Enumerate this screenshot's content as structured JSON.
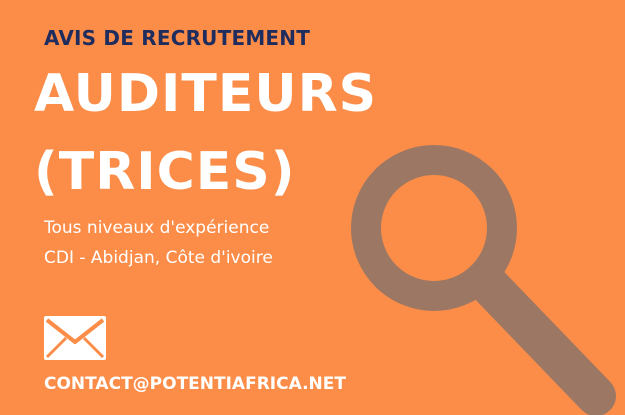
{
  "poster": {
    "kicker": "AVIS DE RECRUTEMENT",
    "headline_line1": "AUDITEURS",
    "headline_line2": "(TRICES)",
    "details": [
      "Tous niveaux d'expérience",
      "CDI - Abidjan, Côte d'ivoire"
    ],
    "contact_email": "CONTACT@POTENTIAFRICA.NET"
  },
  "icons": {
    "magnifier": "magnifying-glass-icon",
    "mail": "envelope-icon"
  },
  "colors": {
    "background": "#fb8d49",
    "kicker_text": "#1f2d5e",
    "headline_text": "#ffffff",
    "magnifier": "#9c7763"
  }
}
